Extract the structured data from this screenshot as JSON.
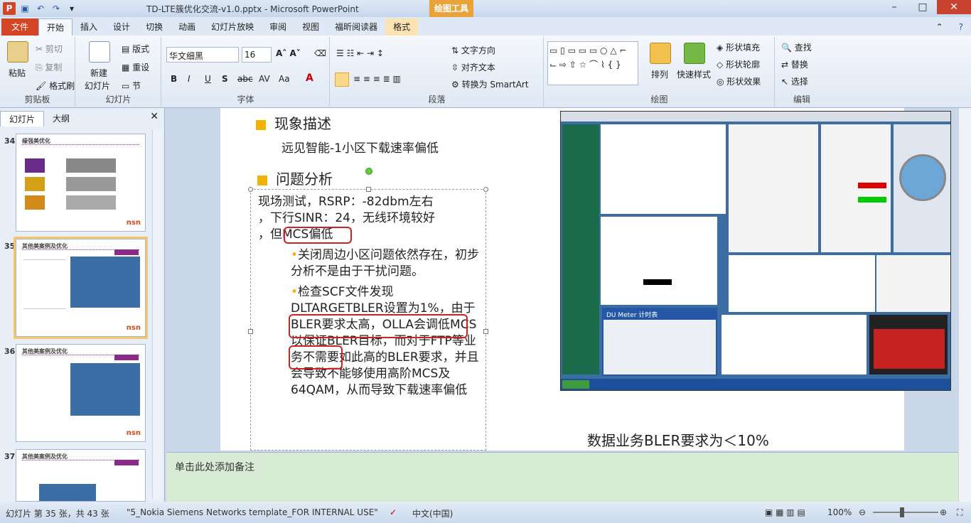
{
  "window": {
    "title": "TD-LTE簇优化交流-v1.0.pptx - Microsoft PowerPoint",
    "contextual_tab": "绘图工具",
    "tabs": [
      "文件",
      "开始",
      "插入",
      "设计",
      "切换",
      "动画",
      "幻灯片放映",
      "审阅",
      "视图",
      "福昕阅读器",
      "格式"
    ]
  },
  "ribbon": {
    "clipboard": {
      "paste": "粘贴",
      "cut": "剪切",
      "copy": "复制",
      "format_painter": "格式刷",
      "label": "剪贴板"
    },
    "slides": {
      "new_slide": "新建",
      "new_slide2": "幻灯片",
      "layout": "版式",
      "reset": "重设",
      "section": "节",
      "label": "幻灯片"
    },
    "font": {
      "name": "华文细黑",
      "size": "16",
      "label": "字体"
    },
    "paragraph": {
      "text_direction": "文字方向",
      "align_text": "对齐文本",
      "smartart": "转换为 SmartArt",
      "label": "段落"
    },
    "drawing": {
      "arrange": "排列",
      "quick_styles": "快速样式",
      "shape_fill": "形状填充",
      "shape_outline": "形状轮廓",
      "shape_effects": "形状效果",
      "label": "绘图"
    },
    "editing": {
      "find": "查找",
      "replace": "替换",
      "select": "选择",
      "label": "编辑"
    }
  },
  "left_pane": {
    "tabs": [
      "幻灯片",
      "大纲"
    ],
    "thumbs": [
      {
        "num": "34",
        "title": "缘强美优化"
      },
      {
        "num": "35",
        "title": "其他美案例及优化"
      },
      {
        "num": "36",
        "title": "其他美案例及优化"
      },
      {
        "num": "37",
        "title": "其他美案例及优化"
      }
    ],
    "logo": "nsn"
  },
  "slide": {
    "h1": "现象描述",
    "h1_body": "远见智能-1小区下载速率偏低",
    "h2": "问题分析",
    "box_line1": "现场测试，RSRP：-82dbm左右",
    "box_line2": "，下行SINR：24，无线环境较好",
    "box_line3a": "，但",
    "box_line3b": "MCS偏低",
    "bullet1": "关闭周边小区问题依然存在，初步分析不是由于干扰问题。",
    "bullet2a": "检查SCF文件发现",
    "bullet2b": "DLTARGETBLER设置为1%",
    "bullet2c": "，由于BLER要求太高，",
    "bullet2d": "OLLA",
    "bullet2e": "会调低MCS以保证BLER目标，而对于FTP等业务不需要如此高的BLER要求，并且会导致不能够使用高阶MCS及64QAM，从而导致下载速率偏低",
    "caption": "数据业务BLER要求为＜10%",
    "screenshot_label": "DU Meter 计时表"
  },
  "notes": {
    "placeholder": "单击此处添加备注"
  },
  "status": {
    "slide_count": "幻灯片 第 35 张，共 43 张",
    "template": "\"5_Nokia Siemens Networks template_FOR INTERNAL USE\"",
    "language": "中文(中国)",
    "zoom": "100%"
  }
}
